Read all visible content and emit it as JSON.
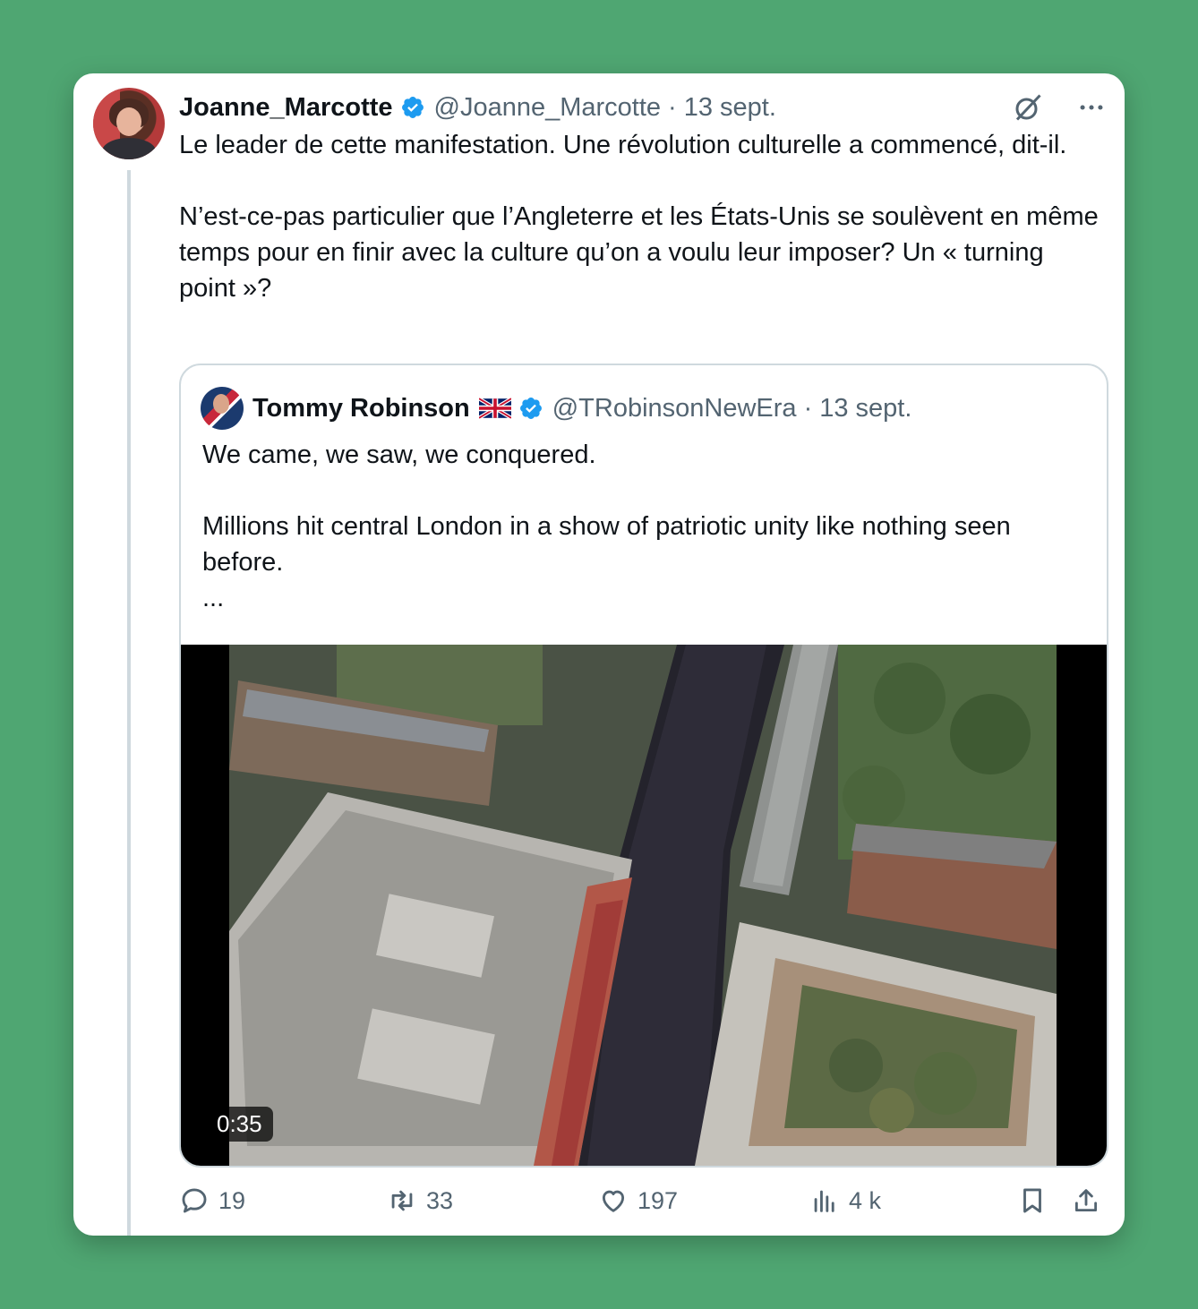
{
  "colors": {
    "background": "#4fa672",
    "text": "#0f1419",
    "secondary_text": "#536471",
    "verified_blue": "#1d9bf0",
    "border": "#cfd9de"
  },
  "tweet": {
    "author_name": "Joanne_Marcotte",
    "author_handle": "@Joanne_Marcotte",
    "separator": "·",
    "date": "13 sept.",
    "text_1": "Le leader de cette manifestation. Une révolution culturelle a commencé, dit-il.",
    "text_2": "N’est-ce-pas particulier que l’Angleterre et les États-Unis se soulèvent en même temps pour en finir avec la culture qu’on a voulu leur imposer? Un « turning point »?",
    "icons": [
      "grok-icon",
      "more-icon"
    ]
  },
  "quote": {
    "author_name": "Tommy Robinson",
    "author_handle": "@TRobinsonNewEra",
    "separator": "·",
    "date": "13 sept.",
    "text_1": "We came, we saw, we conquered.",
    "text_2": "Millions hit central London in a show of patriotic unity like nothing seen before.",
    "text_3": "...",
    "video_duration": "0:35"
  },
  "actions": {
    "replies": "19",
    "reposts": "33",
    "likes": "197",
    "views": "4 k"
  }
}
